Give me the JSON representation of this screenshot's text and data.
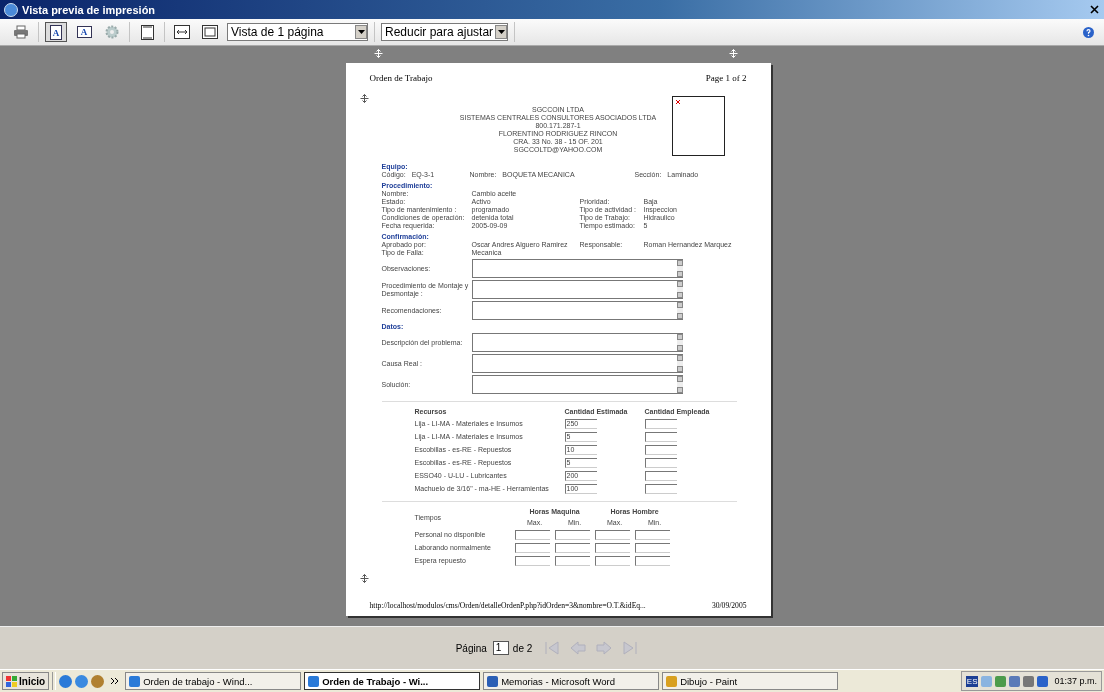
{
  "window": {
    "title": "Vista previa de impresión"
  },
  "toolbar": {
    "buttons": [
      {
        "kind": "print",
        "selected": false
      },
      {
        "kind": "portrait",
        "glyph": "A",
        "selected": true
      },
      {
        "kind": "landscape",
        "glyph": "A",
        "selected": false
      },
      {
        "kind": "setup",
        "selected": false
      },
      {
        "kind": "headers",
        "selected": false
      },
      {
        "kind": "width",
        "selected": false
      },
      {
        "kind": "full",
        "selected": false
      }
    ],
    "selects": [
      "Vista de 1 página",
      "Reducir para ajustar"
    ]
  },
  "document": {
    "title": "Orden de Trabajo",
    "page_label": "Page 1 of 2",
    "company": [
      "SGCCOIN LTDA",
      "SISTEMAS CENTRALES CONSULTORES ASOCIADOS LTDA",
      "800.171.287-1",
      "FLORENTINO RODRIGUEZ RINCON",
      "CRA. 33 No. 38 - 15 OF. 201",
      "SGCCOLTD@YAHOO.COM"
    ],
    "sections": [
      {
        "heading": "Equipo:",
        "kind": "inline",
        "fields": [
          {
            "label": "Código:",
            "value": "EQ-3-1"
          },
          {
            "label": "Nombre:",
            "value": "BOQUETA MECANICA"
          },
          {
            "label": "Sección:",
            "value": "Laminado"
          }
        ]
      },
      {
        "heading": "Procedimiento:",
        "kind": "grid",
        "rows": [
          [
            "Nombre:",
            "Cambio aceite"
          ],
          [
            "Estado:",
            "Activo",
            "Prioridad:",
            "Baja"
          ],
          [
            "Tipo de mantenimiento :",
            "programado",
            "Tipo de actividad :",
            "Inspeccion"
          ],
          [
            "Condiciones de operación:",
            "detenida total",
            "Tipo de Trabajo:",
            "Hidraulico"
          ],
          [
            "Fecha requerida:",
            "2005-09-09",
            "Tiempo estimado:",
            "5"
          ]
        ]
      },
      {
        "heading": "Confirmación:",
        "kind": "grid",
        "rows": [
          [
            "Aprobado por:",
            "Oscar Andres Alguero Ramirez",
            "Responsable:",
            "Roman Hernandez Marquez"
          ],
          [
            "Tipo de Falla:",
            "Mecanica"
          ]
        ],
        "textareas": [
          "Observaciones:",
          "Procedimiento de Montaje y Desmontaje :",
          "Recomendaciones:"
        ]
      },
      {
        "heading": "Datos:",
        "kind": "grid",
        "textareas": [
          "Descripción del problema:",
          "Causa Real :",
          "Solución:"
        ]
      }
    ],
    "resources": {
      "columns": [
        "Recursos",
        "Cantidad Estimada",
        "Cantidad Empleada"
      ],
      "rows": [
        {
          "name": "Lija - LI-MA - Materiales e Insumos",
          "estimated": "250"
        },
        {
          "name": "Lija - LI-MA - Materiales e Insumos",
          "estimated": "5"
        },
        {
          "name": "Escobillas - es-RE - Repuestos",
          "estimated": "10"
        },
        {
          "name": "Escobillas - es-RE - Repuestos",
          "estimated": "5"
        },
        {
          "name": "ESSO40 - U-LU - Lubricantes",
          "estimated": "200"
        },
        {
          "name": "Machuelo de 3/16\" - ma-HE - Herramientas",
          "estimated": "100"
        }
      ]
    },
    "times": {
      "title": "Tiempos",
      "groups": [
        "Horas Maquina",
        "Horas Hombre"
      ],
      "subcolumns": [
        "Max.",
        "Min.",
        "Max.",
        "Min."
      ],
      "rows": [
        "Personal no disponible",
        "Laborando normalmente",
        "Espera repuesto"
      ]
    },
    "footer_url": "http://localhost/modulos/cms/Orden/detalleOrdenP.php?idOrden=3&nombre=O.T.&idEq...",
    "footer_date": "30/09/2005"
  },
  "pager": {
    "label": "Página",
    "page": "1",
    "total": "de 2"
  },
  "taskbar": {
    "start": "Inicio",
    "tasks": [
      {
        "label": "Orden de trabajo - Wind...",
        "kind": "ie",
        "selected": false
      },
      {
        "label": "Orden de Trabajo - Wi...",
        "kind": "ie",
        "selected": true
      },
      {
        "label": "Memorias - Microsoft Word",
        "kind": "word",
        "selected": false
      },
      {
        "label": "Dibujo - Paint",
        "kind": "paint",
        "selected": false
      }
    ],
    "lang": "ES",
    "time": "01:37 p.m."
  }
}
